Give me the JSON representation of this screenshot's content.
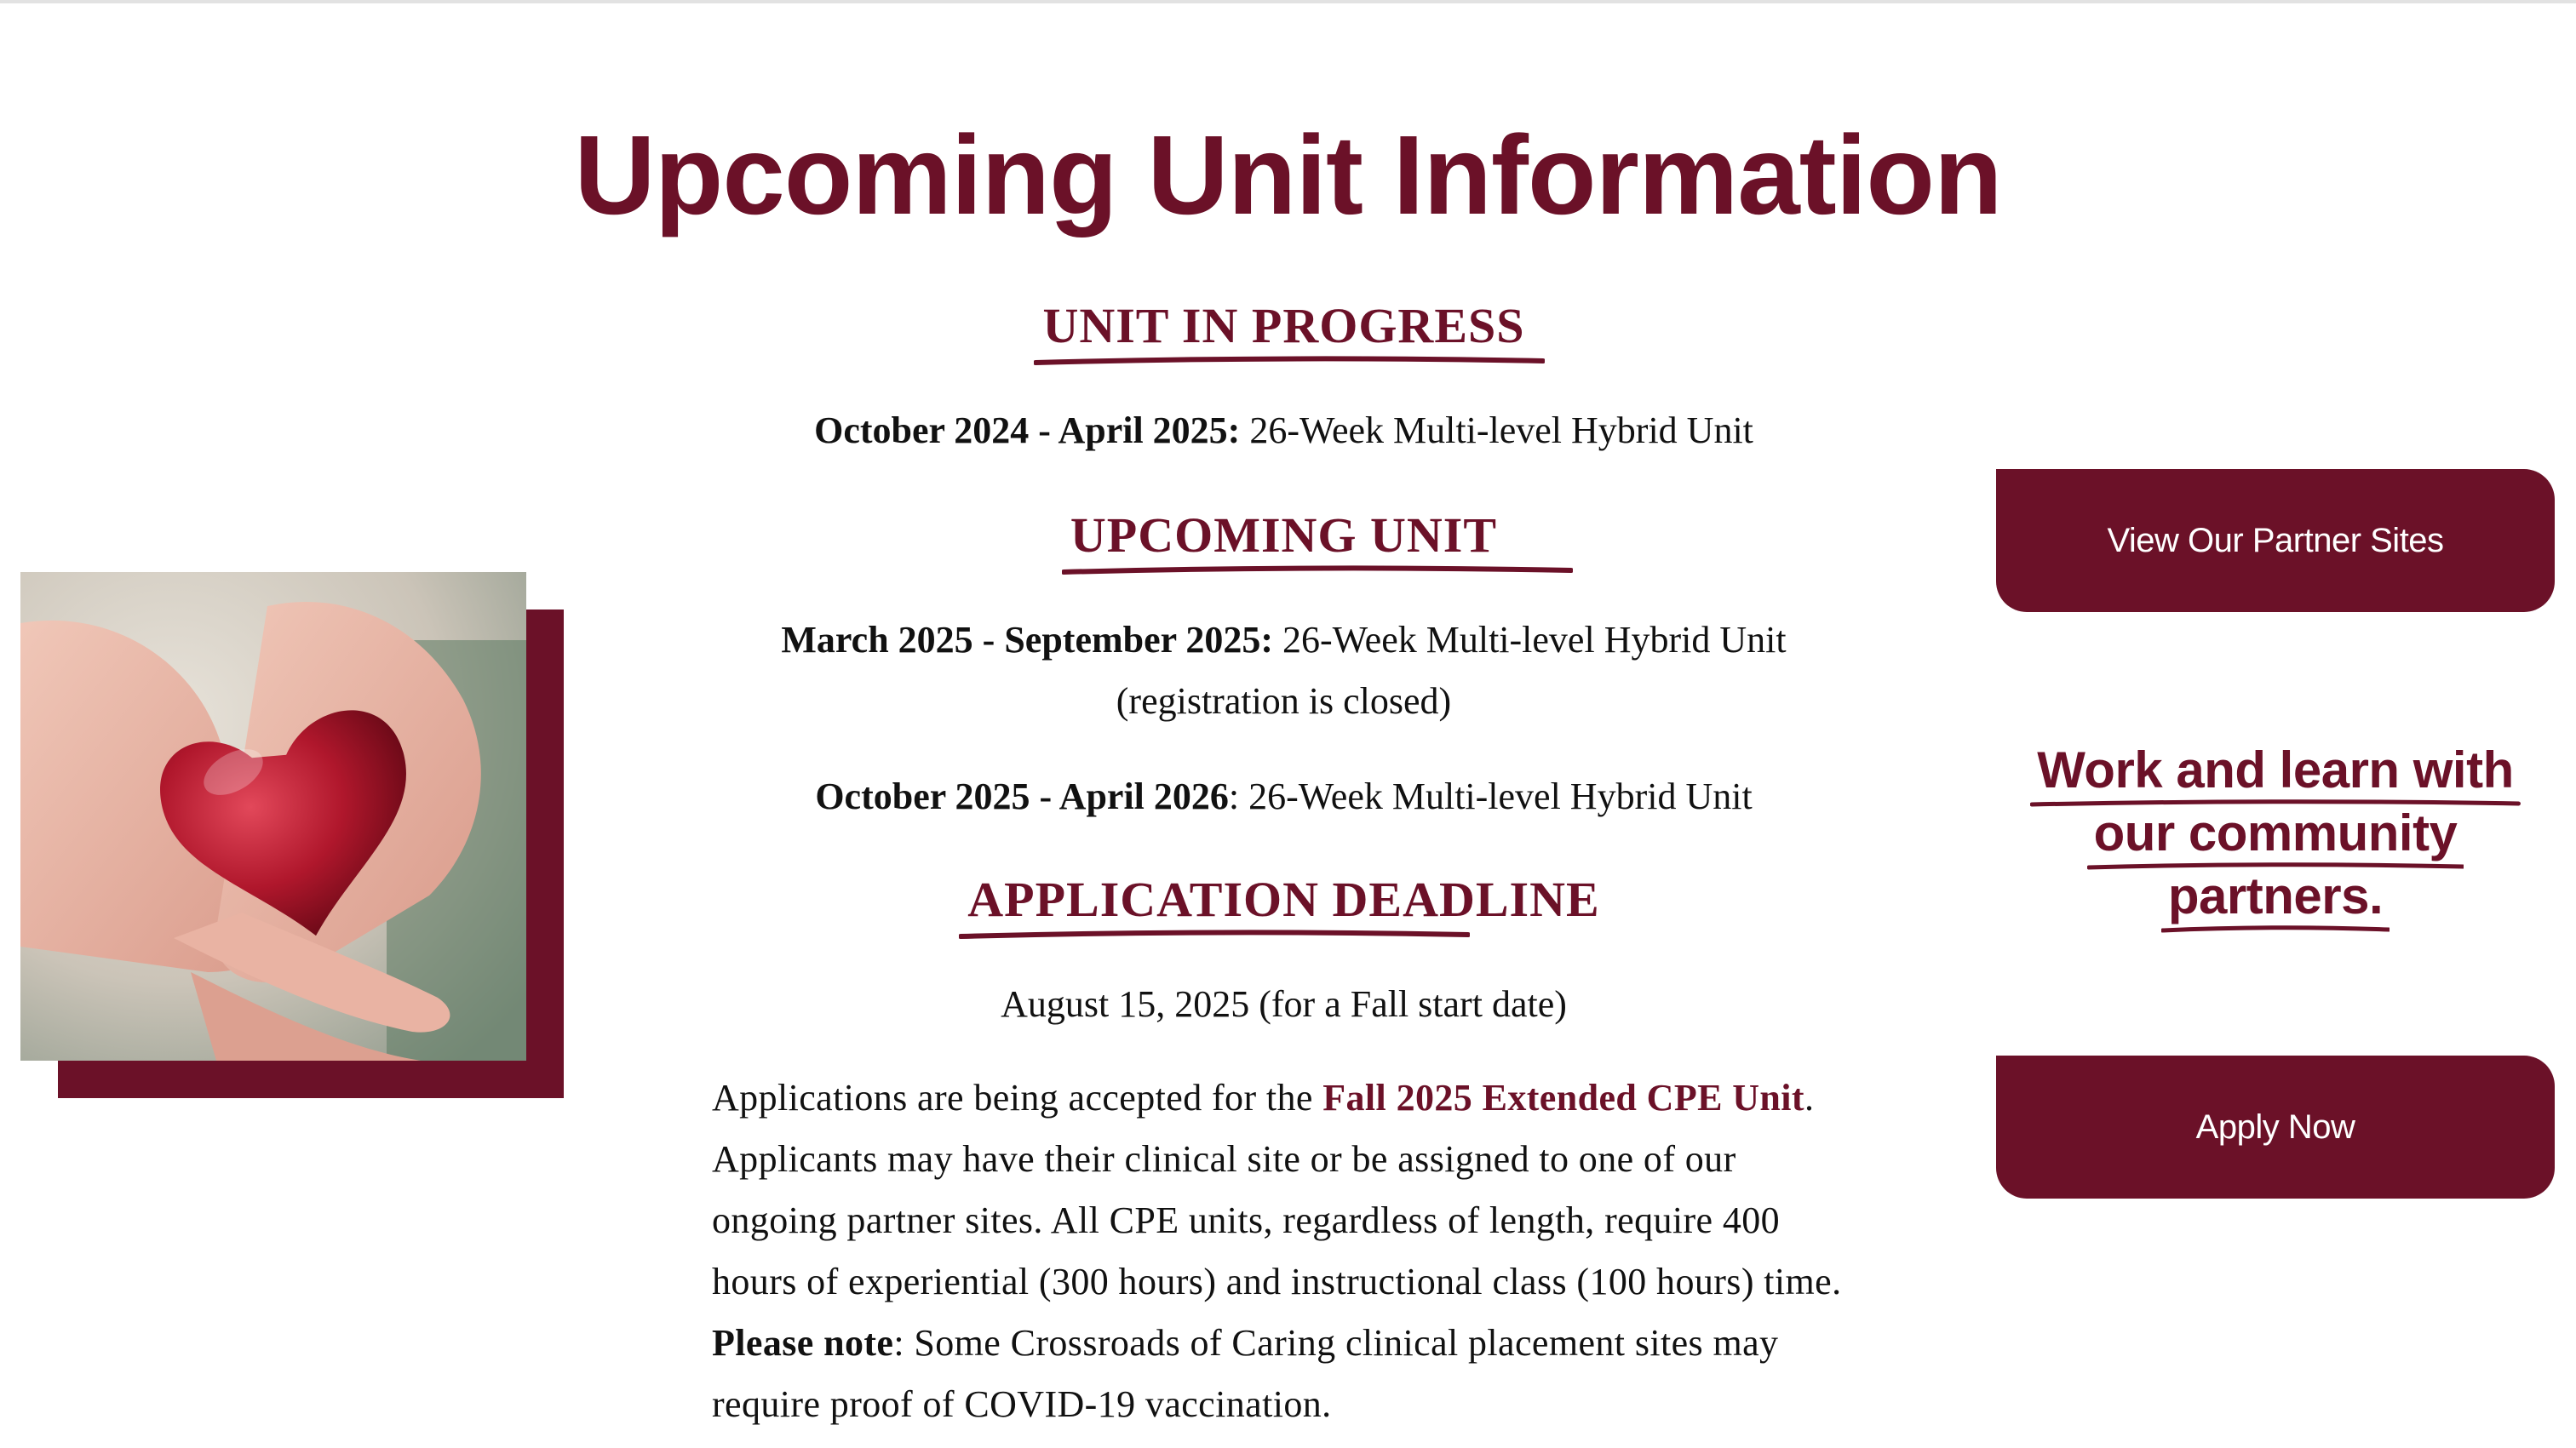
{
  "page": {
    "title": "Upcoming Unit Information",
    "accent_color": "#6b1128"
  },
  "sections": {
    "in_progress": {
      "heading": "UNIT IN PROGRESS",
      "line1_bold": "October 2024 - April 2025:",
      "line1_rest": " 26-Week Multi-level Hybrid Unit"
    },
    "upcoming": {
      "heading": "UPCOMING UNIT",
      "line1_bold": "March 2025 - September 2025:",
      "line1_rest": " 26-Week Multi-level Hybrid Unit",
      "line1_cont": "(registration is closed)",
      "line2_bold": "October 2025 - April 2026",
      "line2_rest": ": 26-Week Multi-level Hybrid Unit"
    },
    "deadline": {
      "heading": "APPLICATION DEADLINE",
      "date_line": "August 15, 2025 (for a Fall start date)"
    }
  },
  "paragraph": {
    "intro": "Applications are being accepted for the ",
    "accent": "Fall 2025 Extended CPE Unit",
    "mid": ". Applicants may have their clinical site or be assigned to one of our ongoing partner sites. All CPE units, regardless of length, require 400 hours of experiential (300 hours) and instructional class (100 hours) time. ",
    "note_bold": "Please note",
    "note_rest": ": Some Crossroads of Caring clinical placement sites may require proof of COVID-19 vaccination."
  },
  "sidebar": {
    "partners_button": "View Our Partner Sites",
    "tagline_lines": [
      "Work and learn with",
      "our community",
      "partners."
    ],
    "apply_button": "Apply Now"
  },
  "image": {
    "icon": "heart-in-hands-photo"
  }
}
